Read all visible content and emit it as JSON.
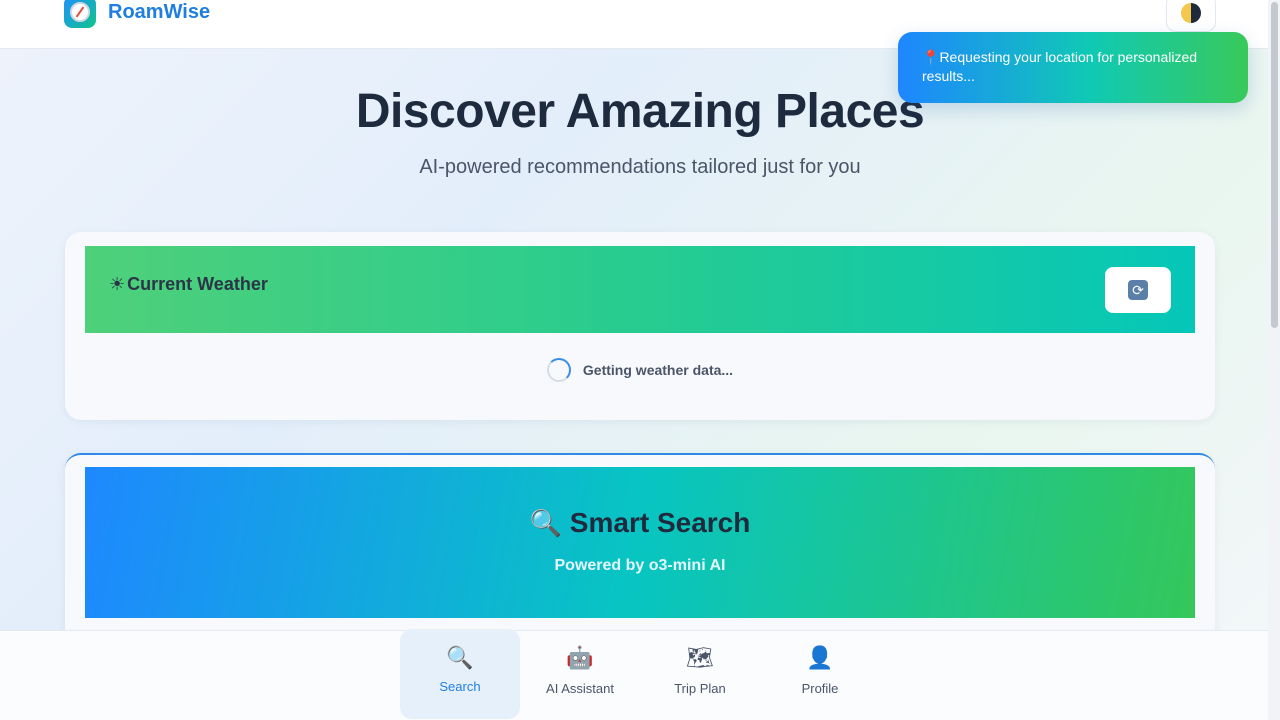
{
  "app": {
    "brand": "RoamWise",
    "logo_icon": "compass-icon",
    "theme_toggle_icon": "half-moon-icon"
  },
  "hero": {
    "title": "Discover Amazing Places",
    "subtitle": "AI-powered recommendations tailored just for you"
  },
  "toast": {
    "icon": "pin-icon",
    "message": "Requesting your location for personalized results..."
  },
  "weather": {
    "title": "Current Weather",
    "title_icon": "sun-cloud-icon",
    "refresh_icon": "refresh-icon",
    "loading_text": "Getting weather data..."
  },
  "search": {
    "title": "Smart Search",
    "title_icon": "magnifier-icon",
    "subtitle": "Powered by o3-mini AI"
  },
  "nav": {
    "items": [
      {
        "label": "Search",
        "icon": "magnifier-icon",
        "active": true
      },
      {
        "label": "AI Assistant",
        "icon": "robot-icon",
        "active": false
      },
      {
        "label": "Trip Plan",
        "icon": "map-icon",
        "active": false
      },
      {
        "label": "Profile",
        "icon": "user-icon",
        "active": false
      }
    ]
  },
  "colors": {
    "brand": "#1e7fe0",
    "accent_green": "#34c75a",
    "accent_teal": "#08c5c2"
  }
}
